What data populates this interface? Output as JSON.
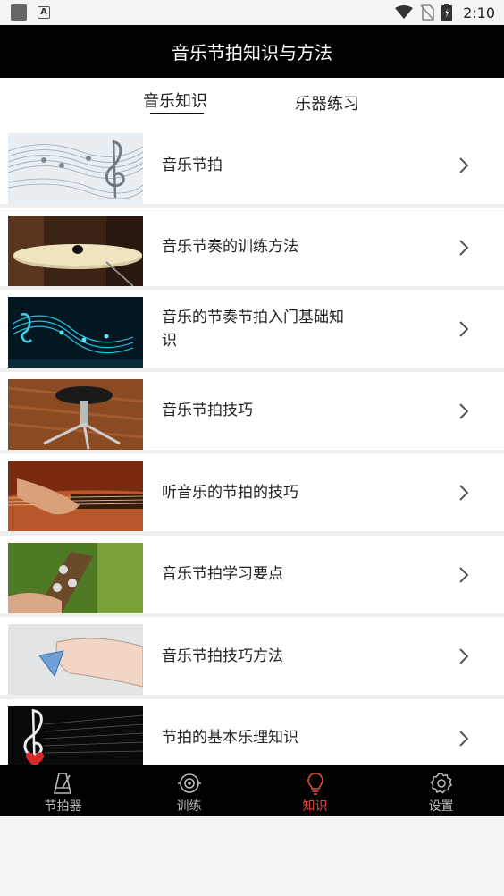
{
  "status_bar": {
    "time": "2:10"
  },
  "title": "音乐节拍知识与方法",
  "tabs": [
    {
      "label": "音乐知识",
      "active": true
    },
    {
      "label": "乐器练习",
      "active": false
    }
  ],
  "items": [
    {
      "label": "音乐节拍",
      "thumb": "sheet-music-image"
    },
    {
      "label": "音乐节奏的训练方法",
      "thumb": "cymbal-image"
    },
    {
      "label": "音乐的节奏节拍入门基础知识",
      "thumb": "music-notes-blue-image"
    },
    {
      "label": "音乐节拍技巧",
      "thumb": "drum-stool-image"
    },
    {
      "label": "听音乐的节拍的技巧",
      "thumb": "guitar-strumming-image"
    },
    {
      "label": "音乐节拍学习要点",
      "thumb": "guitar-tuning-image"
    },
    {
      "label": "音乐节拍技巧方法",
      "thumb": "guitar-pick-image"
    },
    {
      "label": "节拍的基本乐理知识",
      "thumb": "treble-clef-heart-image"
    }
  ],
  "bottom_nav": [
    {
      "label": "节拍器",
      "icon": "metronome-icon",
      "active": false
    },
    {
      "label": "训练",
      "icon": "training-icon",
      "active": false
    },
    {
      "label": "知识",
      "icon": "lightbulb-icon",
      "active": true
    },
    {
      "label": "设置",
      "icon": "settings-gear-icon",
      "active": false
    }
  ],
  "colors": {
    "title_bar": "#000000",
    "active_nav": "#e8453c",
    "nav_inactive": "#bbbbbb"
  }
}
